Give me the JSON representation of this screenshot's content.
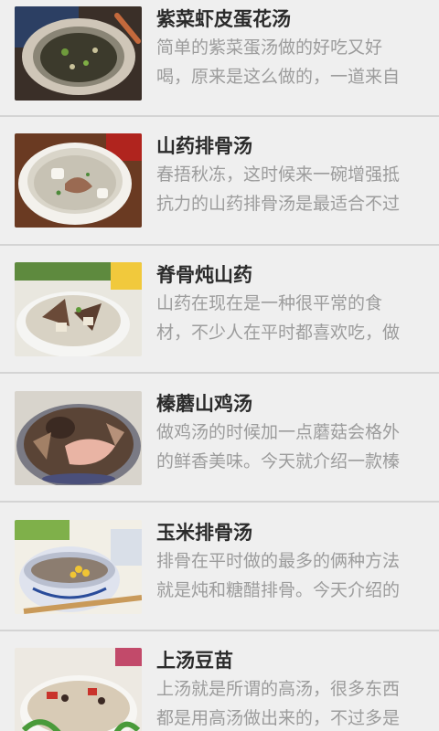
{
  "recipes": [
    {
      "title": "紫菜虾皮蛋花汤",
      "desc": "简单的紫菜蛋汤做的好吃又好喝，原来是这么做的，一道来自",
      "thumb_icon": "soup-photo"
    },
    {
      "title": "山药排骨汤",
      "desc": "春捂秋冻，这时候来一碗增强抵抗力的山药排骨汤是最适合不过",
      "thumb_icon": "soup-photo"
    },
    {
      "title": "脊骨炖山药",
      "desc": "山药在现在是一种很平常的食材，不少人在平时都喜欢吃，做",
      "thumb_icon": "soup-photo"
    },
    {
      "title": "榛蘑山鸡汤",
      "desc": "做鸡汤的时候加一点蘑菇会格外的鲜香美味。今天就介绍一款榛",
      "thumb_icon": "soup-photo"
    },
    {
      "title": "玉米排骨汤",
      "desc": "排骨在平时做的最多的俩种方法就是炖和糖醋排骨。今天介绍的",
      "thumb_icon": "soup-photo"
    },
    {
      "title": "上汤豆苗",
      "desc": "上汤就是所谓的高汤，很多东西都是用高汤做出来的，不过多是",
      "thumb_icon": "soup-photo"
    }
  ]
}
